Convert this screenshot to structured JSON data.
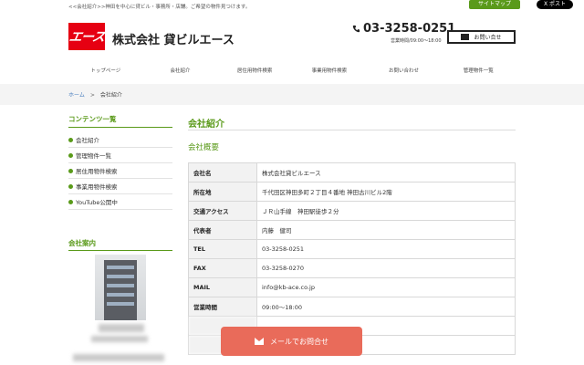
{
  "header": {
    "tagline": "<<会社紹介>>神田を中心に貸ビル・事務所・店舗。ご希望の物件見つけます。",
    "sitemap_label": "サイトマップ",
    "xpost_label": "X ポスト",
    "logo_text": "エース",
    "company_name": "株式会社 貸ビルエース",
    "phone": "03-3258-0251",
    "hours": "営業時間/09:00〜18:00",
    "contact_label": "お問い合せ"
  },
  "nav": {
    "items": [
      "トップページ",
      "会社紹介",
      "居住用物件検索",
      "事業用物件検索",
      "お問い合わせ",
      "管理物件一覧"
    ]
  },
  "breadcrumb": {
    "home": "ホーム",
    "separator": ">",
    "current": "会社紹介"
  },
  "sidebar": {
    "contents_title": "コンテンツ一覧",
    "items": [
      "会社紹介",
      "管理物件一覧",
      "居住用物件検索",
      "事業用物件検索",
      "YouTube公開中"
    ],
    "guide_title": "会社案内"
  },
  "main": {
    "title": "会社紹介",
    "subtitle": "会社概要",
    "rows": [
      {
        "key": "会社名",
        "value": "株式会社貸ビルエース"
      },
      {
        "key": "所在地",
        "value": "千代田区神田多町２丁目４番地 神田古川ビル2階"
      },
      {
        "key": "交通アクセス",
        "value": "ＪＲ山手線　神田駅徒歩２分"
      },
      {
        "key": "代表者",
        "value": "内藤　健司"
      },
      {
        "key": "TEL",
        "value": "03-3258-0251"
      },
      {
        "key": "FAX",
        "value": "03-3258-0270"
      },
      {
        "key": "MAIL",
        "value": "info@kb-ace.co.jp"
      },
      {
        "key": "営業時間",
        "value": "09:00〜18:00"
      }
    ]
  },
  "floating": {
    "mail_label": "メールでお問合せ"
  },
  "colors": {
    "accent_green": "#5a9a1a",
    "logo_red": "#e60012",
    "mail_button": "#e96b5a"
  }
}
